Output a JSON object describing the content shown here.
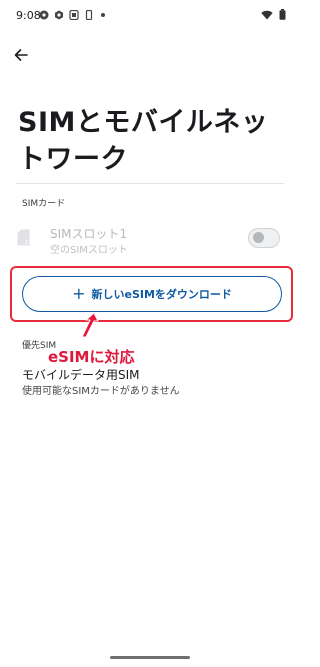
{
  "status_bar": {
    "time": "9:08",
    "icons": [
      "gear-icon",
      "settings-icon",
      "screenshot-icon",
      "phone-icon",
      "dot-icon",
      "wifi-icon",
      "battery-icon"
    ]
  },
  "header": {
    "back_icon": "arrow-left-icon",
    "title": "SIMとモバイルネットワーク"
  },
  "sim_section": {
    "label": "SIMカード",
    "slot": {
      "title": "SIMスロット1",
      "subtitle": "空のSIMスロット",
      "toggle_on": false
    },
    "download_button": {
      "icon": "plus-icon",
      "label": "新しいeSIMをダウンロード"
    }
  },
  "annotation": {
    "text": "eSIMに対応",
    "color": "#e0183c"
  },
  "preferred_section": {
    "label": "優先SIM",
    "item_title": "モバイルデータ用SIM",
    "item_subtitle": "使用可能なSIMカードがありません"
  },
  "colors": {
    "accent": "#0f5aa3",
    "highlight": "#ea2b3c"
  }
}
